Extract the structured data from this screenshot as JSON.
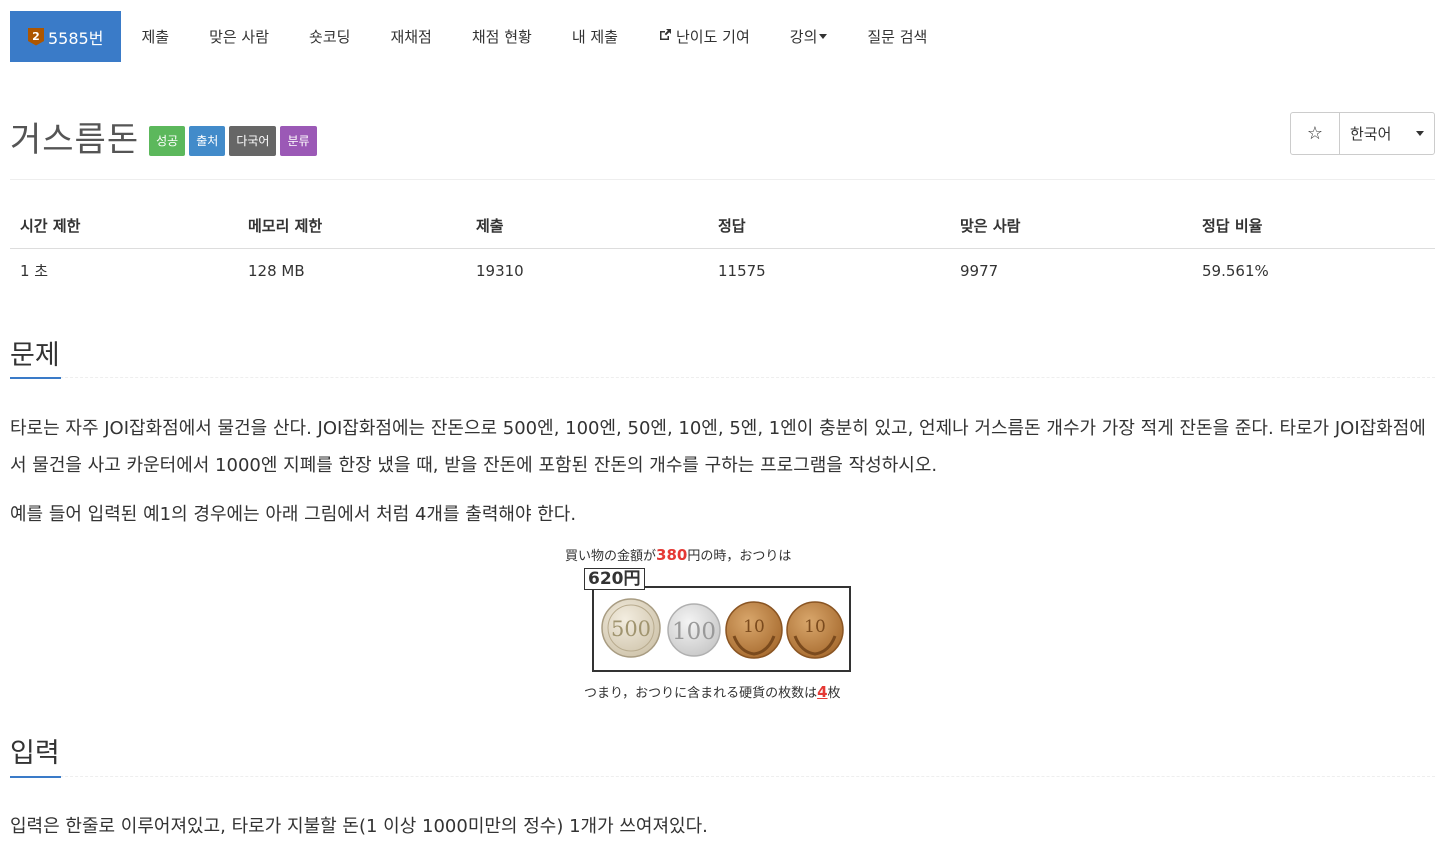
{
  "nav": {
    "brand_tier": "2",
    "brand_label": "5585번",
    "items": [
      "제출",
      "맞은 사람",
      "숏코딩",
      "재채점",
      "채점 현황",
      "내 제출",
      "난이도 기여",
      "강의",
      "질문 검색"
    ]
  },
  "problem": {
    "title": "거스름돈",
    "labels": [
      {
        "text": "성공",
        "color": "#5cb85c"
      },
      {
        "text": "출처",
        "color": "#428bca"
      },
      {
        "text": "다국어",
        "color": "#666666"
      },
      {
        "text": "분류",
        "color": "#9b59b6"
      }
    ]
  },
  "controls": {
    "star_icon": "☆",
    "language": "한국어"
  },
  "info": {
    "headers": [
      "시간 제한",
      "메모리 제한",
      "제출",
      "정답",
      "맞은 사람",
      "정답 비율"
    ],
    "values": [
      "1 초",
      "128 MB",
      "19310",
      "11575",
      "9977",
      "59.561%"
    ]
  },
  "sections": {
    "problem_heading": "문제",
    "problem_text_1": "타로는 자주 JOI잡화점에서 물건을 산다. JOI잡화점에는 잔돈으로 500엔, 100엔, 50엔, 10엔, 5엔, 1엔이 충분히 있고, 언제나 거스름돈 개수가 가장 적게 잔돈을 준다. 타로가 JOI잡화점에서 물건을 사고 카운터에서 1000엔 지폐를 한장 냈을 때, 받을 잔돈에 포함된 잔돈의 개수를 구하는 프로그램을 작성하시오.",
    "problem_text_2": "예를 들어 입력된 예1의 경우에는 아래 그림에서 처럼 4개를 출력해야 한다.",
    "input_heading": "입력",
    "input_text": "입력은 한줄로 이루어져있고, 타로가 지불할 돈(1 이상 1000미만의 정수) 1개가 쓰여져있다."
  },
  "figure": {
    "top_prefix": "買い物の金額が",
    "top_amount": "380",
    "top_suffix": "円の時，おつりは",
    "change_amount": "620円",
    "coins": [
      "500",
      "100",
      "10",
      "10"
    ],
    "bottom_prefix": "つまり，おつりに含まれる硬貨の枚数は",
    "bottom_count": "4",
    "bottom_suffix": "枚"
  }
}
